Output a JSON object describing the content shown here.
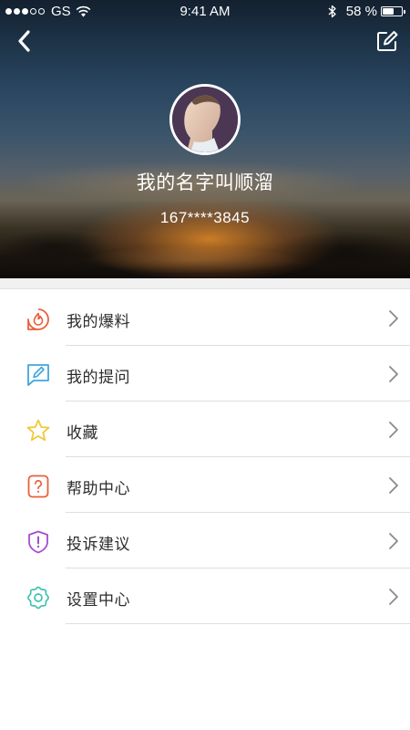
{
  "status_bar": {
    "carrier": "GS",
    "time": "9:41 AM",
    "battery_percent": "58 %",
    "battery_level": 0.58,
    "signal_bars_filled": 3,
    "signal_bars_total": 5
  },
  "nav": {
    "back_icon": "chevron-left-icon",
    "edit_icon": "edit-icon"
  },
  "profile": {
    "name": "我的名字叫顺溜",
    "phone": "167****3845"
  },
  "menu": {
    "items": [
      {
        "label": "我的爆料",
        "icon": "flame-icon",
        "color": "#e8603c"
      },
      {
        "label": "我的提问",
        "icon": "pencil-chat-icon",
        "color": "#3fa7dc"
      },
      {
        "label": "收藏",
        "icon": "star-icon",
        "color": "#f0c93a"
      },
      {
        "label": "帮助中心",
        "icon": "question-icon",
        "color": "#e8603c"
      },
      {
        "label": "投诉建议",
        "icon": "shield-alert-icon",
        "color": "#a64ccf"
      },
      {
        "label": "设置中心",
        "icon": "gear-icon",
        "color": "#3ec3b0"
      }
    ]
  }
}
